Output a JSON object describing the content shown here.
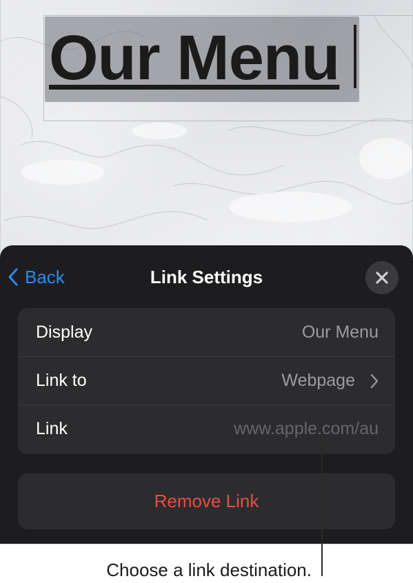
{
  "document": {
    "title_text": "Our Menu"
  },
  "sheet": {
    "back_label": "Back",
    "title": "Link Settings",
    "close_icon": "close-icon",
    "rows": [
      {
        "label": "Display",
        "value": "Our Menu"
      },
      {
        "label": "Link to",
        "value": "Webpage"
      },
      {
        "label": "Link",
        "value": "www.apple.com/au"
      }
    ],
    "remove_label": "Remove Link"
  },
  "caption": "Choose a link destination.",
  "colors": {
    "accent_blue": "#2f89f5",
    "destructive_red": "#ea4d43",
    "sheet_background": "#1d1d1f",
    "group_background": "#2c2c2e"
  },
  "icons": {
    "back": "chevron-left-icon",
    "link_to": "chevron-right-icon"
  }
}
